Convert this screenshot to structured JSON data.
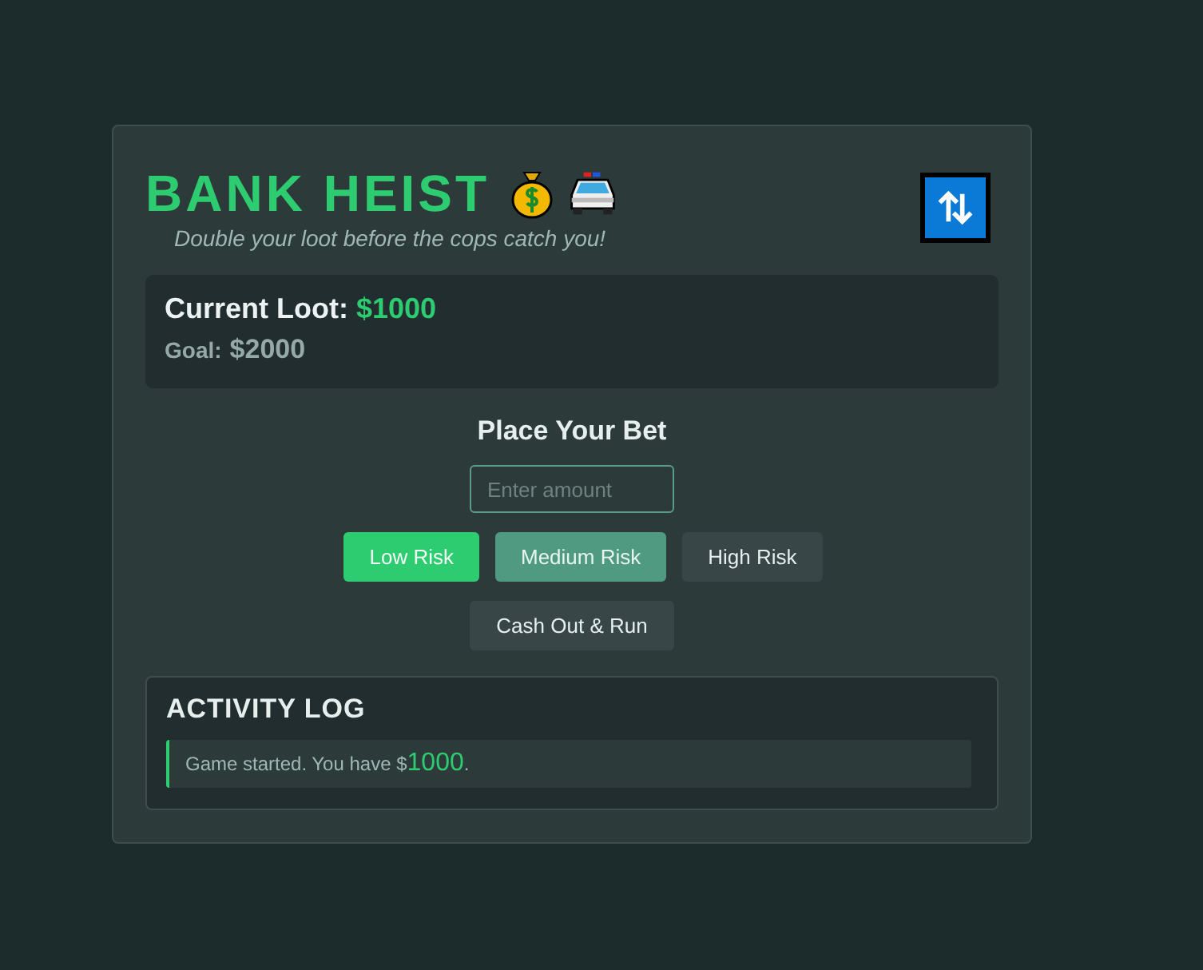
{
  "header": {
    "title": "BANK HEIST",
    "subtitle": "Double your loot before the cops catch you!"
  },
  "loot": {
    "label": "Current Loot:",
    "value": "$1000",
    "goal_label": "Goal:",
    "goal_value": "$2000"
  },
  "bet": {
    "heading": "Place Your Bet",
    "placeholder": "Enter amount"
  },
  "risks": [
    {
      "label": "Low Risk",
      "selected": true,
      "highlighted": false
    },
    {
      "label": "Medium Risk",
      "selected": false,
      "highlighted": true
    },
    {
      "label": "High Risk",
      "selected": false,
      "highlighted": false
    }
  ],
  "cash_out": "Cash Out & Run",
  "log": {
    "title": "ACTIVITY LOG",
    "entries": [
      {
        "text": "Game started. You have $",
        "amount": "1000",
        "end": "."
      }
    ]
  }
}
